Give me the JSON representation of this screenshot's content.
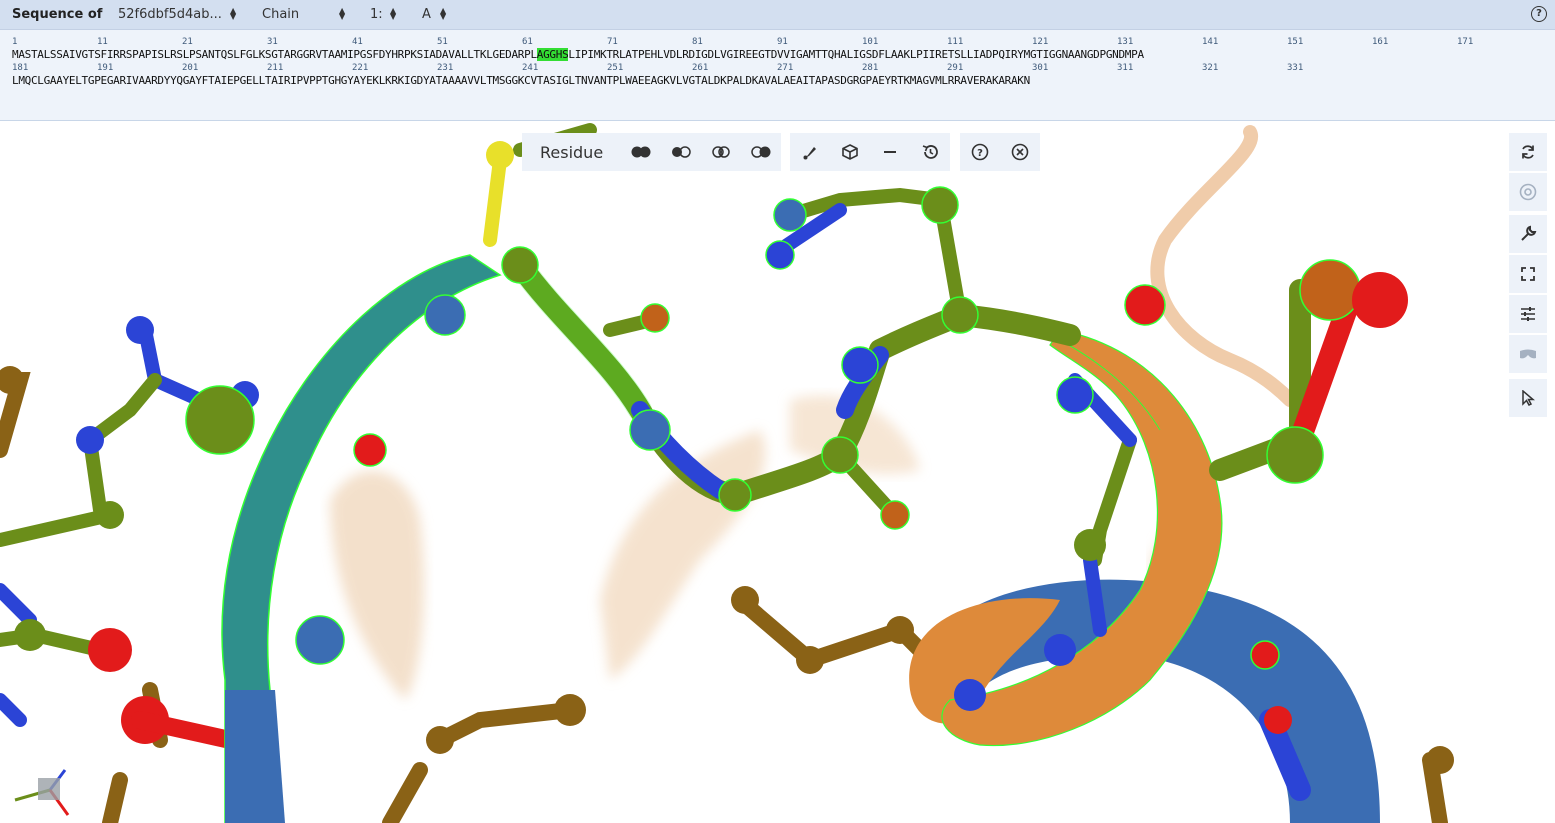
{
  "header": {
    "label": "Sequence of",
    "entry_select": "52f6dbf5d4ab...",
    "mode_select": "Chain",
    "index_select": "1:",
    "chain_select": "A"
  },
  "sequence": {
    "line1": "MASTALSSAIVGTSFIRRSPAPISLRSLPSANTQSLFGLKSGTARGGRVTAAMIPGSFDYHRPKSIADAVALLTKLGEDARPL",
    "highlight": "AGGHS",
    "line1_rest": "LIPIMKTRLATPEHLVDLRDIGDLVGIREEGTDVVIGAMTTQHALIGSDFLAAKLPIIRETSLLIADPQIRYMGTIGGNAANGDPGNDMPA",
    "line2": "LMQCLGAAYELTGPEGARIVAARDYYQGAYFTAIEPGELLTAIRIPVPPTGHGYAYEKLKRKIGDYATAAAAVVLTMSGGKCVTASIGLTNVANTPLWAEEAGKVLVGTALDKPALDKAVALAEAITAPASDGRGPAEYRTKMAGVMLRRAVERAKARAKN",
    "numbers_row1": [
      "1",
      "11",
      "21",
      "31",
      "41",
      "51",
      "61",
      "71",
      "81",
      "91",
      "101",
      "111",
      "121",
      "131",
      "141",
      "151",
      "161",
      "171"
    ],
    "numbers_row2": [
      "181",
      "191",
      "201",
      "211",
      "221",
      "231",
      "241",
      "251",
      "261",
      "271",
      "281",
      "291",
      "301",
      "311",
      "321",
      "331"
    ]
  },
  "toolbar": {
    "label": "Residue",
    "buttons": [
      "select-all-icon",
      "select-left-icon",
      "intersect-icon",
      "select-right-icon",
      "brush-icon",
      "cube-icon",
      "minus-icon",
      "history-icon",
      "help-icon",
      "close-icon"
    ]
  },
  "sidebar": {
    "buttons": [
      "reset-icon",
      "screenshot-icon",
      "wrench-icon",
      "fullscreen-icon",
      "sliders-icon",
      "vr-icon",
      "cursor-icon"
    ]
  },
  "colors": {
    "topbar": "#d3dff0",
    "sequence_panel": "#eef3fa",
    "highlight": "#33dd33",
    "carbon": "#6b8e1a",
    "nitrogen": "#2b44d6",
    "oxygen": "#e21b1b",
    "sulfur": "#e8e02a",
    "ribbon_orange": "#de8a3a",
    "ribbon_blue": "#3b6db3",
    "selection_outline": "#33ff33"
  }
}
